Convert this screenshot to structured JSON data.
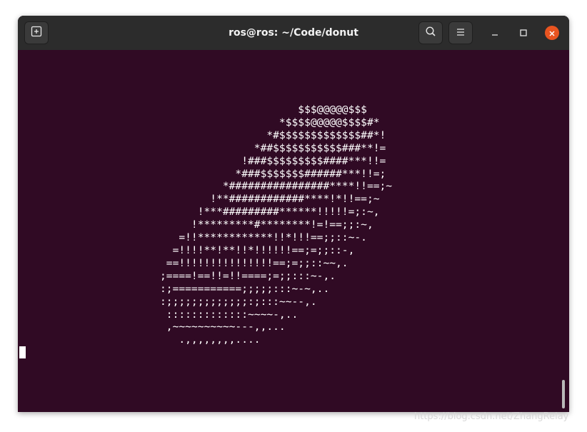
{
  "window": {
    "title": "ros@ros: ~/Code/donut"
  },
  "titlebar": {
    "new_tab_icon": "new-tab-icon",
    "search_icon": "search-icon",
    "menu_icon": "hamburger-menu-icon",
    "minimize_icon": "minimize-icon",
    "maximize_icon": "maximize-icon",
    "close_icon": "close-icon"
  },
  "terminal": {
    "background": "#300a24",
    "foreground": "#ffffff",
    "output": "                      $$$@@@@@$$$\n                   *$$$$@@@@@$$$$#*\n                 *#$$$$$$$$$$$$$##*!\n               *##$$$$$$$$$$$###**!=\n             !###$$$$$$$$$####***!!=\n            *###$$$$$$$######***!!=;\n          *################****!!==;~\n        !**############****!*!!==;~\n      !***#########******!!!!!=;:~,\n     !*********#********!=!==;;:~,\n   =!!************!!*!!!==;;::~-.\n  =!!!!**!**!!*!!!!!!==;=;;::-,\n ==!!!!!!!!!!!!!!!==;=;;::~~,.\n;====!==!!=!!====;=;;:::~-,.\n:;===========;;;;;:::~-~,..\n:;;;;;;;;;;;;;:;:::~~--,.\n :::::::::::::~~~~-,..\n ,~~~~~~~~~~---,,...\n   .,,,,,,,,...."
  },
  "colors": {
    "titlebar": "#2c2c2c",
    "close_button": "#e95420",
    "title_text": "#f2f2f2"
  },
  "watermark": "https://blog.csdn.net/ZhangRelay"
}
